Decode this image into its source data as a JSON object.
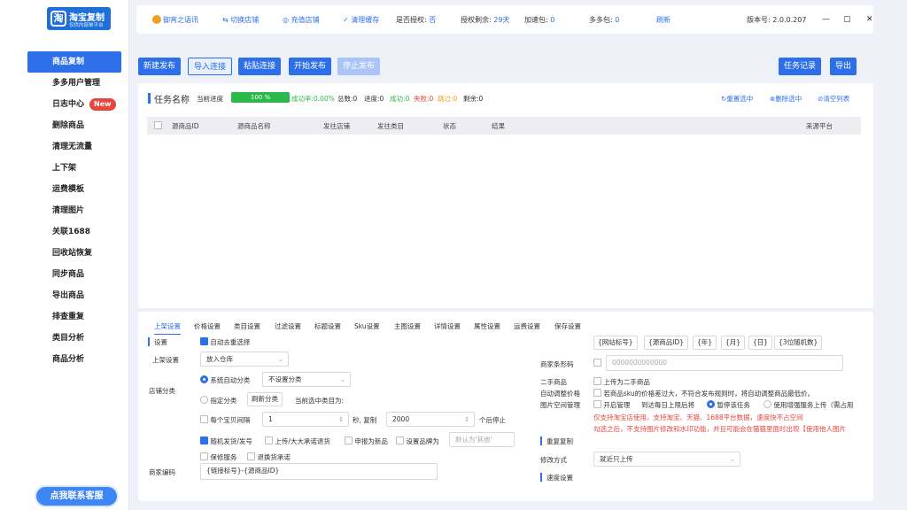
{
  "app": {
    "logo_title": "淘宝复制",
    "logo_subtitle": "仅供内部单平台",
    "logo_icon": "淘",
    "version": "版本号: 2.0.0.207"
  },
  "sidebar": {
    "items": [
      {
        "label": "商品复制",
        "active": true
      },
      {
        "label": "多多用户管理"
      },
      {
        "label": "日志中心",
        "badge": "New"
      },
      {
        "label": "删除商品"
      },
      {
        "label": "清理无流量"
      },
      {
        "label": "上下架"
      },
      {
        "label": "运费模板"
      },
      {
        "label": "清理图片"
      },
      {
        "label": "关联1688"
      },
      {
        "label": "回收站恢复"
      },
      {
        "label": "同步商品"
      },
      {
        "label": "导出商品"
      },
      {
        "label": "排查重复"
      },
      {
        "label": "类目分析"
      },
      {
        "label": "商品分析"
      }
    ],
    "contact": "点我联系客服"
  },
  "topbar": {
    "shop": "御宵之语讯",
    "switch": "切换店铺",
    "recharge": "充值店铺",
    "clear_cache": "清理缓存",
    "authorized": "是否授权:",
    "authorized_val": "否",
    "remaining": "授权剩余:",
    "remaining_val": "29天",
    "accel": "加速包:",
    "accel_val": "0",
    "multi": "多多包:",
    "multi_val": "0",
    "refresh": "刷新",
    "win_min": "—",
    "win_max": "▢",
    "win_close": "✕"
  },
  "toolbar": {
    "new_publish": "新建发布",
    "import_link": "导入连接",
    "paste_link": "粘贴连接",
    "start_publish": "开始发布",
    "stop_publish": "停止发布",
    "task_log": "任务记录",
    "export": "导出"
  },
  "task": {
    "title": "任务名称",
    "progress_label": "当前进度",
    "progress_text": "100 %",
    "progress": 1.0,
    "success_rate": "成功率:0.00%",
    "total": "总数:0",
    "in_progress": "进度:0",
    "success": "成功:0",
    "fail": "失败:0",
    "skip": "跳过:0",
    "remaining": "剩余:0",
    "reselect": "重置选中",
    "delete_selected": "删除选中",
    "clear_list": "清空列表"
  },
  "table": {
    "headers": [
      "源商品ID",
      "源商品名称",
      "发往店铺",
      "发往类目",
      "状态",
      "结果",
      "来源平台"
    ]
  },
  "settings": {
    "tabs": [
      "上架设置",
      "价格设置",
      "类目设置",
      "过滤设置",
      "标题设置",
      "Sku设置",
      "主图设置",
      "详情设置",
      "属性设置",
      "运费设置",
      "保存设置"
    ],
    "section_settings": "设置",
    "auto_dedup": "自动去重选择",
    "upload_label": "上架设置",
    "upload_value": "放入仓库",
    "category_label": "店铺分类",
    "auto_category": "系统自动分类",
    "auto_category_value": "不设置分类",
    "specify_category": "指定分类",
    "refresh_category": "刷新分类",
    "current_selected": "当前选中类目为:",
    "every_label": "每个宝贝间隔",
    "every_val": "1",
    "seconds": "秒, 复制",
    "copy_count": "2000",
    "pause": "个后停止",
    "opt_manual": "随机发货/发号",
    "opt_return": "上传/大大承诺退货",
    "opt_new": "申报为新品",
    "opt_brand": "设置品牌为",
    "brand_ph": "默认为'其他'",
    "opt_warranty": "保修服务",
    "opt_refund": "退换货承诺",
    "merchant_code_label": "商家编码",
    "merchant_code_value": "{链接标号}-{源商品ID}",
    "tags": [
      "{网站标号}",
      "{源商品ID}",
      "{年}",
      "{月}",
      "{日}",
      "{3位随机数}"
    ],
    "barcode_label": "商家条形码",
    "barcode_ph": "0000000000000",
    "second_hand_label": "二手商品",
    "second_hand_opt": "上传为二手商品",
    "auto_price_label": "自动调整价格",
    "auto_price_opt": "若商品sku的价格差过大，不符合发布规则时，将自动调整商品最低价。",
    "img_space_label": "图片空间管理",
    "img_space_opt": "开启管理",
    "img_space_text": "到达每日上限后将",
    "pause_task": "暂停该任务",
    "use_service": "使用增强服务上传（需占用",
    "note1": "仅支持淘宝店使用，支持淘宝、天猫、1688平台数据，速度快不占空间",
    "note2": "勾选之后，不支持图片修改和水印功能，并且可能会在猫猫里面时出现【使用他人图片",
    "repeat_copy": "重复复制",
    "modify_label": "修改方式",
    "modify_value": "就近只上传",
    "speed_setting": "速度设置"
  },
  "colors": {
    "accent": "#2d6fe8",
    "success": "#2db84c",
    "danger": "#e8453c"
  }
}
